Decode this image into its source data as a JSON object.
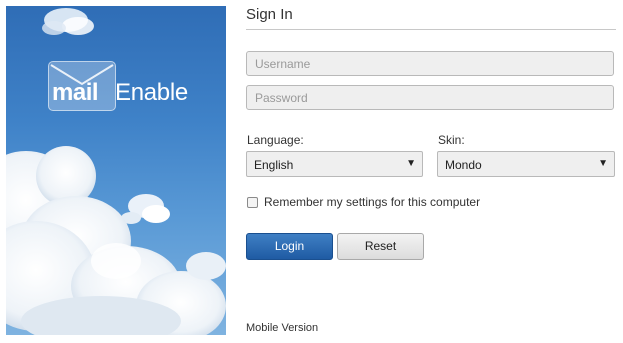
{
  "branding": {
    "logo_part1": "mail",
    "logo_part2": "Enable"
  },
  "form": {
    "title": "Sign In",
    "username_placeholder": "Username",
    "password_placeholder": "Password",
    "language_label": "Language:",
    "language_value": "English",
    "skin_label": "Skin:",
    "skin_value": "Mondo",
    "dropdown_arrow": "▼",
    "remember_label": "Remember my settings for this computer",
    "remember_checked": false,
    "login_button": "Login",
    "reset_button": "Reset",
    "mobile_link": "Mobile Version"
  },
  "icons": {
    "logo": "envelope-icon",
    "dropdown": "chevron-down-icon"
  },
  "colors": {
    "login_button": "#1f5ba3",
    "sky": "#3f82c8"
  }
}
